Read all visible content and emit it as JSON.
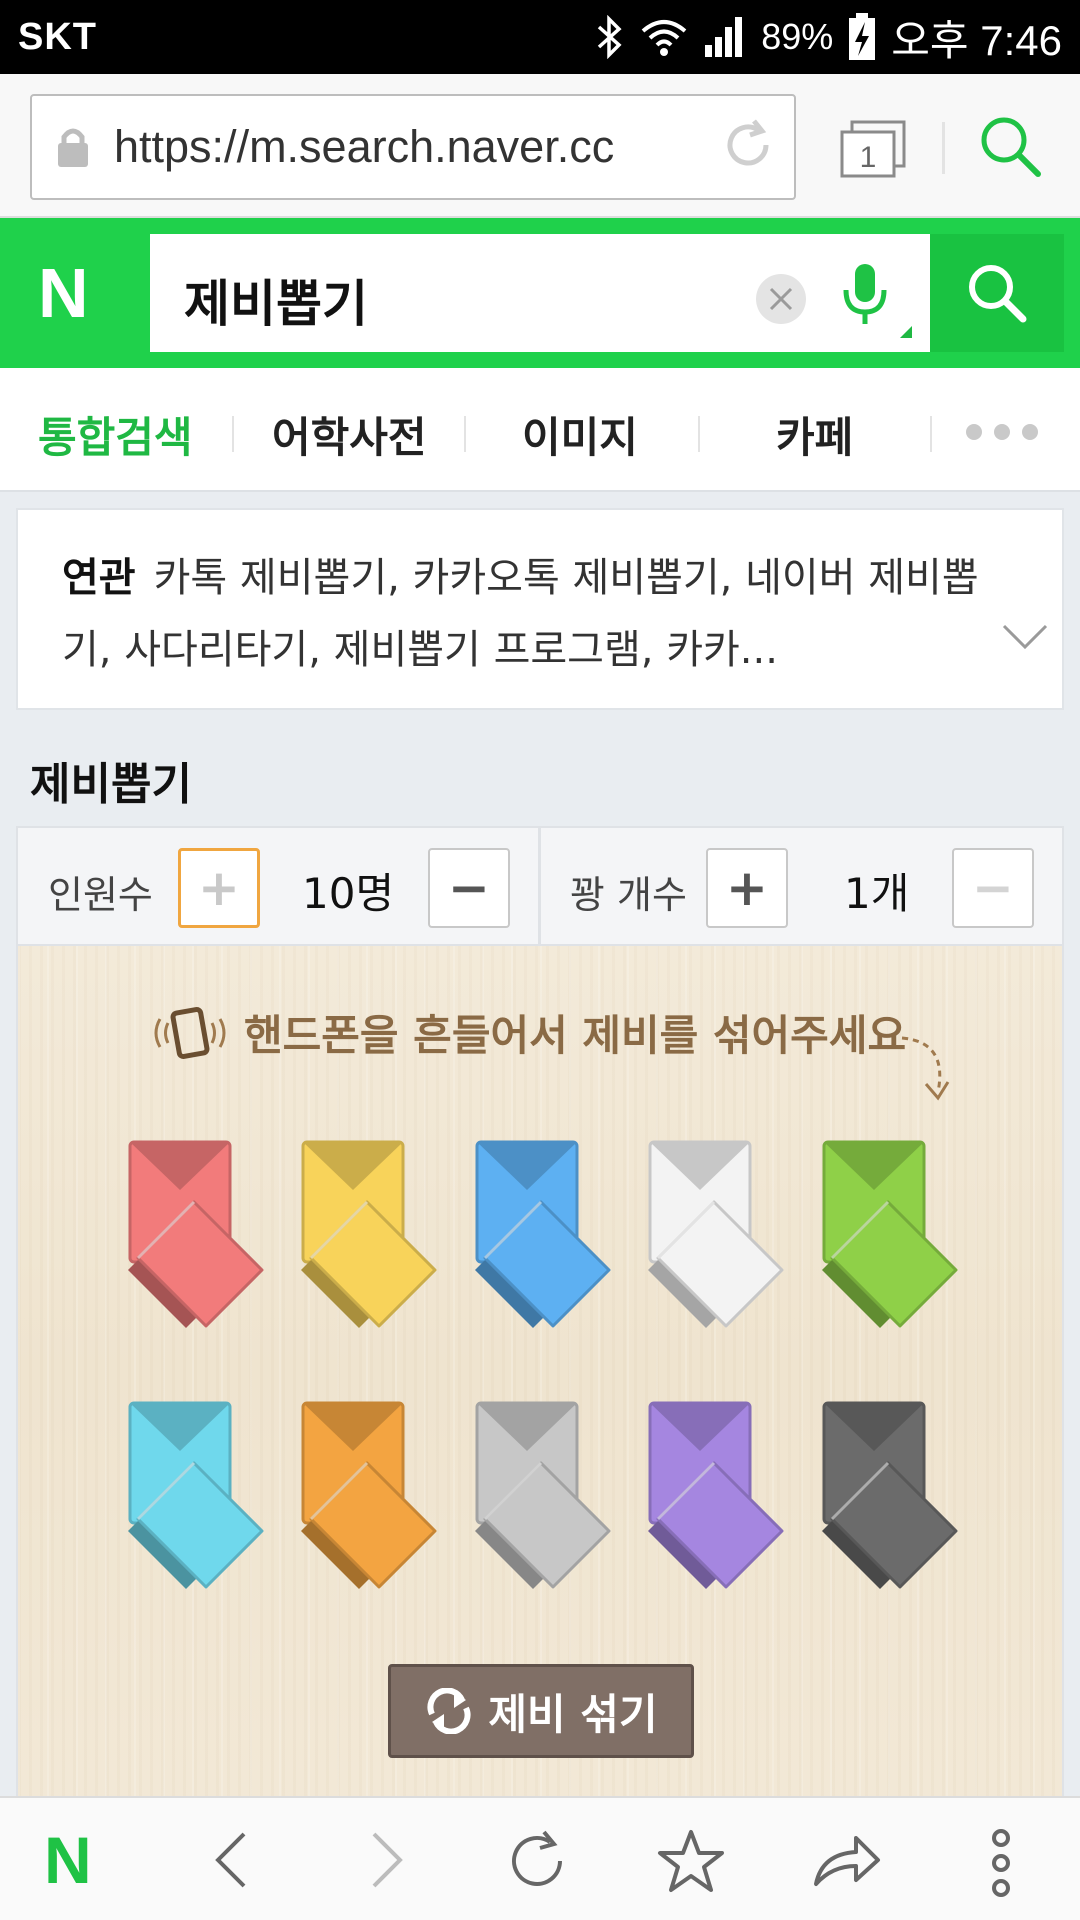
{
  "status_bar": {
    "carrier": "SKT",
    "battery": "89%",
    "time": "오후 7:46"
  },
  "browser": {
    "url": "https://m.search.naver.cc",
    "tab_count": "1"
  },
  "search": {
    "logo": "N",
    "query": "제비뽑기"
  },
  "tabs": [
    {
      "label": "통합검색",
      "active": true
    },
    {
      "label": "어학사전",
      "active": false
    },
    {
      "label": "이미지",
      "active": false
    },
    {
      "label": "카페",
      "active": false
    }
  ],
  "related": {
    "label": "연관",
    "text": "카톡 제비뽑기, 카카오톡 제비뽑기, 네이버 제비뽑기, 사다리타기, 제비뽑기 프로그램, 카카..."
  },
  "lottery": {
    "title": "제비뽑기",
    "people_label": "인원수",
    "people_value": "10명",
    "winner_label": "꽝 개수",
    "winner_value": "1개",
    "plus": "+",
    "minus": "−",
    "hint": "핸드폰을 흔들어서 제비를 섞어주세요",
    "shuffle_label": "제비 섞기",
    "colors": [
      "#f27b7b",
      "#f8d35a",
      "#5db0f2",
      "#f3f3f3",
      "#8fd048",
      "#6fd8ec",
      "#f3a441",
      "#c7c7c7",
      "#a586e0",
      "#6b6b6b"
    ]
  },
  "bottom_bar": {
    "logo": "N"
  }
}
